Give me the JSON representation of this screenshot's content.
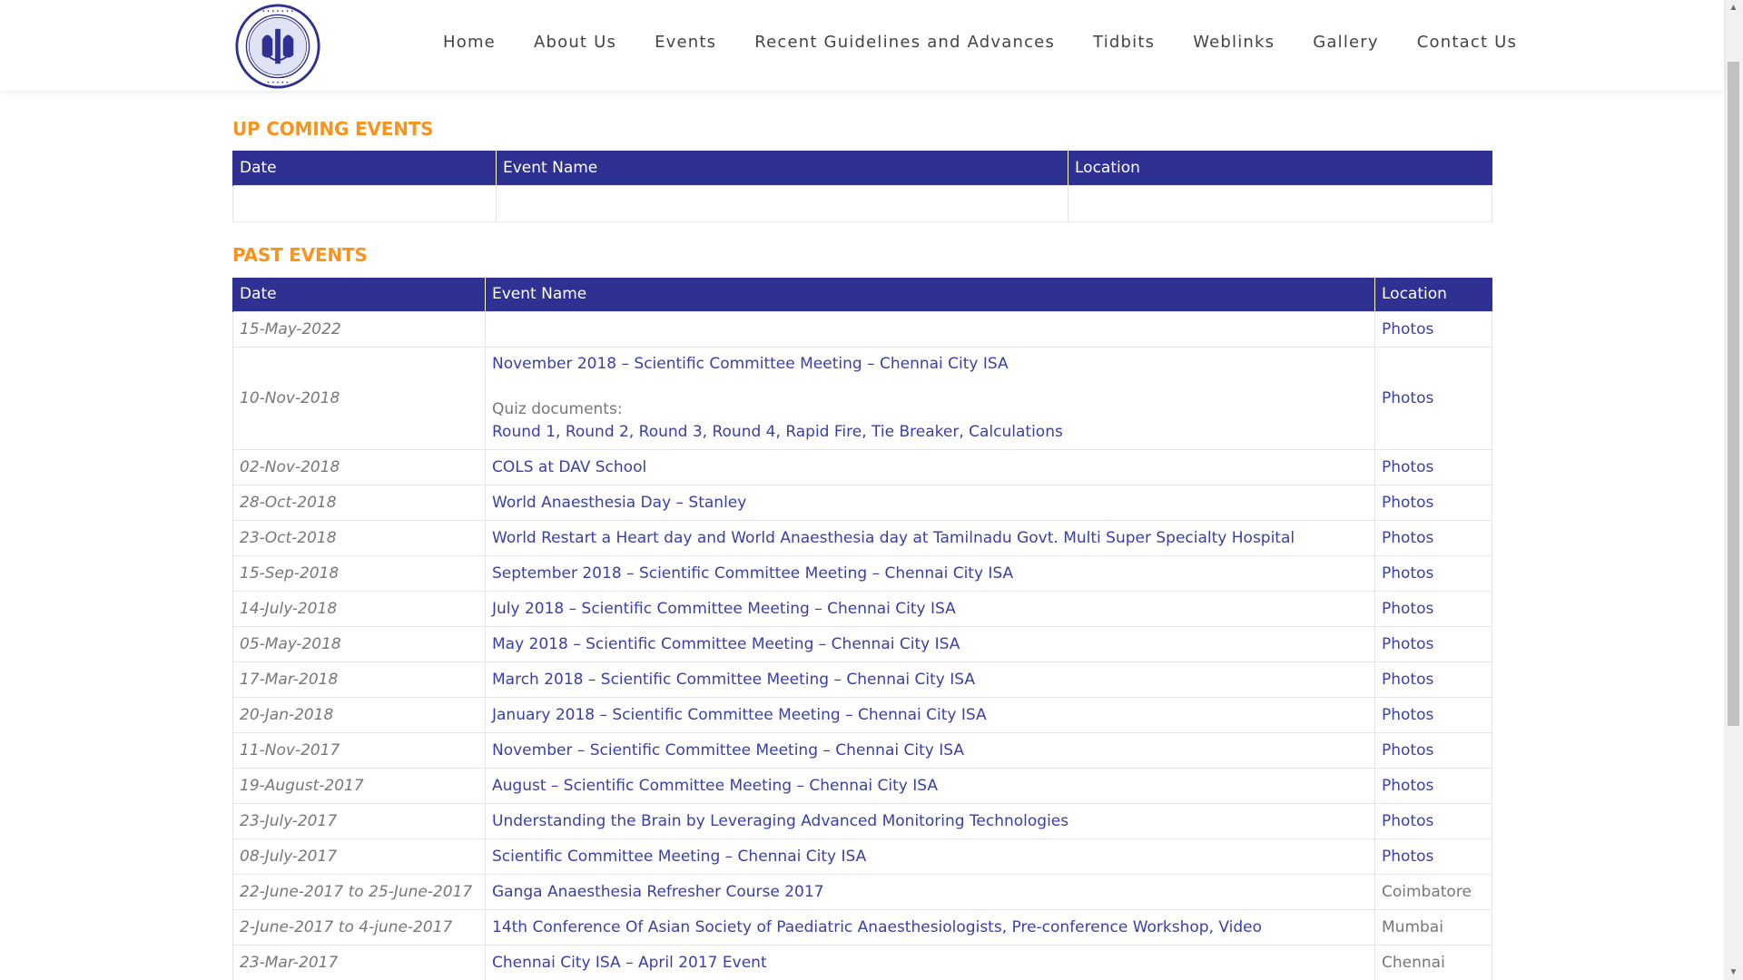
{
  "nav": {
    "items": [
      "Home",
      "About Us",
      "Events",
      "Recent Guidelines and Advances",
      "Tidbits",
      "Weblinks",
      "Gallery",
      "Contact Us"
    ]
  },
  "logo": {
    "text_top": "INDIAN SOCIETY OF ANAESTHESIOLOGISTS",
    "text_bottom": "FOUNDED 1947"
  },
  "colors": {
    "accent": "#f7941d",
    "header_bg": "#2e3192",
    "link": "#3a3fa8"
  },
  "upcoming": {
    "title": "UP COMING EVENTS",
    "headers": [
      "Date",
      "Event Name",
      "Location"
    ]
  },
  "past": {
    "title": "PAST EVENTS",
    "headers": [
      "Date",
      "Event Name",
      "Location"
    ],
    "quiz_label": "Quiz documents:",
    "quiz_links": [
      "Round 1",
      "Round 2",
      "Round 3",
      "Round 4",
      "Rapid Fire",
      "Tie Breaker",
      "Calculations"
    ],
    "rows": [
      {
        "date": "15-May-2022",
        "event": "",
        "location": "Photos",
        "loc_link": true
      },
      {
        "date": "10-Nov-2018",
        "event": "November 2018 – Scientific Committee Meeting – Chennai City ISA",
        "location": "Photos",
        "loc_link": true,
        "quiz": true
      },
      {
        "date": "02-Nov-2018",
        "event": "COLS at DAV School",
        "location": "Photos",
        "loc_link": true
      },
      {
        "date": "28-Oct-2018",
        "event": "World Anaesthesia Day – Stanley",
        "location": "Photos",
        "loc_link": true
      },
      {
        "date": "23-Oct-2018",
        "event": "World Restart a Heart day and World Anaesthesia day at Tamilnadu Govt. Multi Super Specialty Hospital",
        "location": "Photos",
        "loc_link": true
      },
      {
        "date": "15-Sep-2018",
        "event": "September 2018 – Scientific Committee Meeting – Chennai City ISA",
        "location": "Photos",
        "loc_link": true
      },
      {
        "date": "14-July-2018",
        "event": "July 2018 – Scientific Committee Meeting – Chennai City ISA",
        "location": "Photos",
        "loc_link": true
      },
      {
        "date": "05-May-2018",
        "event": "May 2018 – Scientific Committee Meeting – Chennai City ISA",
        "location": "Photos",
        "loc_link": true
      },
      {
        "date": "17-Mar-2018",
        "event": "March 2018 – Scientific Committee Meeting – Chennai City ISA",
        "location": "Photos",
        "loc_link": true
      },
      {
        "date": "20-Jan-2018",
        "event": "January 2018 – Scientific Committee Meeting – Chennai City ISA",
        "location": "Photos",
        "loc_link": true
      },
      {
        "date": "11-Nov-2017",
        "event": "November – Scientific Committee Meeting – Chennai City ISA",
        "location": "Photos",
        "loc_link": true
      },
      {
        "date": "19-August-2017",
        "event": "August – Scientific Committee Meeting – Chennai City ISA",
        "location": "Photos",
        "loc_link": true
      },
      {
        "date": "23-July-2017",
        "event": "Understanding the Brain by Leveraging Advanced Monitoring Technologies",
        "location": "Photos",
        "loc_link": true
      },
      {
        "date": "08-July-2017",
        "event": "Scientific Committee Meeting – Chennai City ISA",
        "location": "Photos",
        "loc_link": true
      },
      {
        "date": "22-June-2017 to 25-June-2017",
        "event": "Ganga Anaesthesia Refresher Course 2017",
        "location": "Coimbatore",
        "loc_link": false
      },
      {
        "date": "2-June-2017 to 4-june-2017",
        "event_parts": [
          "14th Conference Of Asian Society of Paediatric Anaesthesiologists",
          "Pre-conference Workshop",
          "Video"
        ],
        "location": "Mumbai",
        "loc_link": false
      },
      {
        "date": "23-Mar-2017",
        "event": "Chennai City ISA – April 2017 Event",
        "location": "Chennai",
        "loc_link": false
      },
      {
        "date": "",
        "event": "",
        "location": "",
        "loc_link": false
      }
    ]
  }
}
